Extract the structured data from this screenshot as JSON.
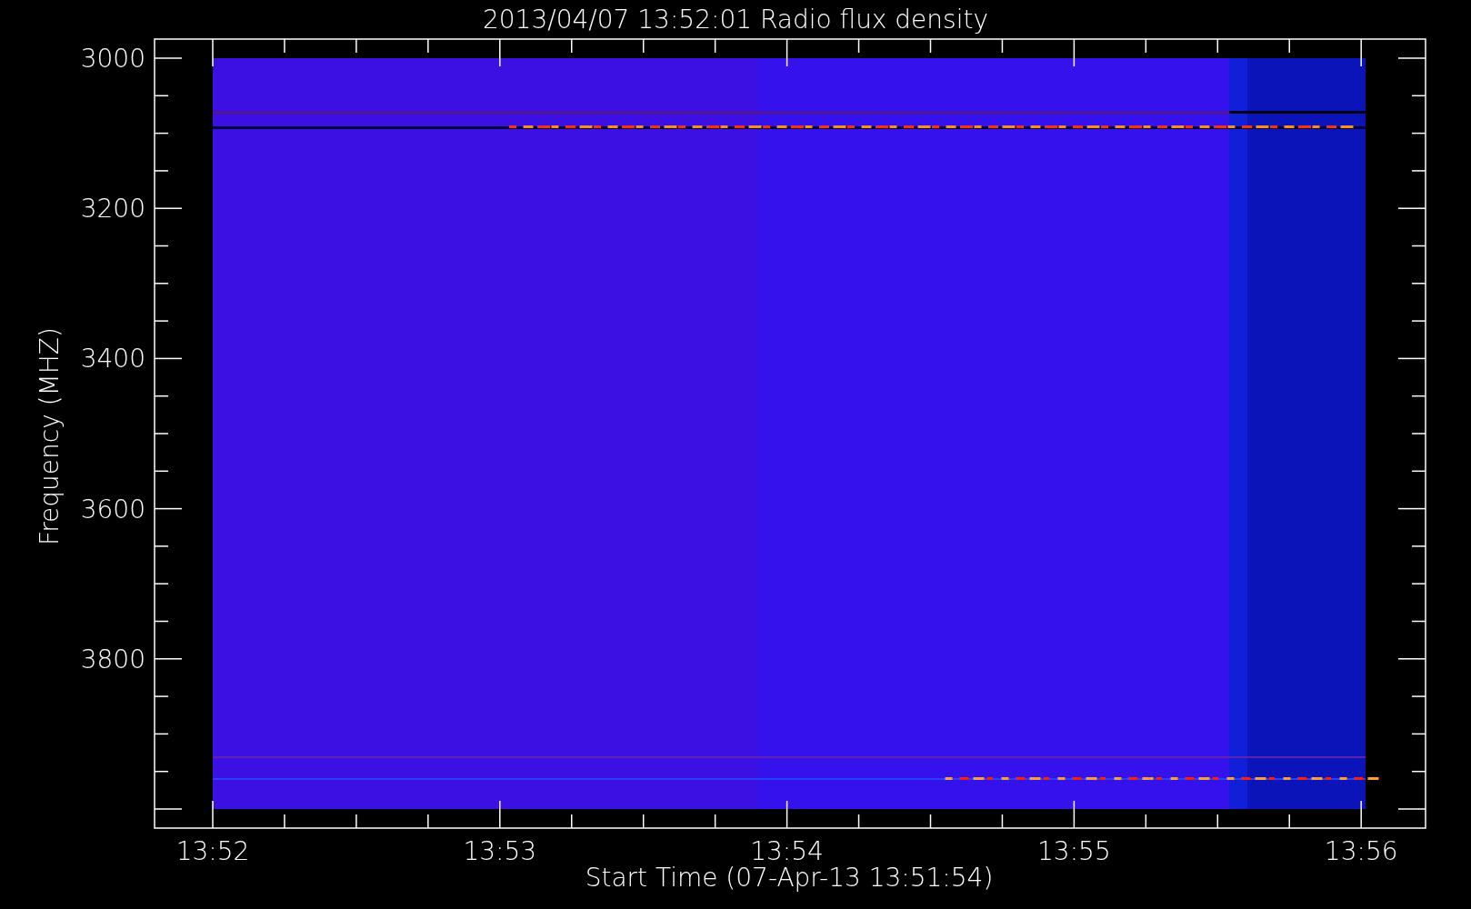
{
  "title": "2013/04/07 13:52:01 Radio flux density",
  "y_axis": {
    "label": "Frequency (MHZ)",
    "ticks": [
      "3000",
      "3200",
      "3400",
      "3600",
      "3800"
    ]
  },
  "x_axis": {
    "label": "Start Time (07-Apr-13 13:51:54)",
    "ticks": [
      "13:52",
      "13:53",
      "13:54",
      "13:55",
      "13:56"
    ]
  }
}
